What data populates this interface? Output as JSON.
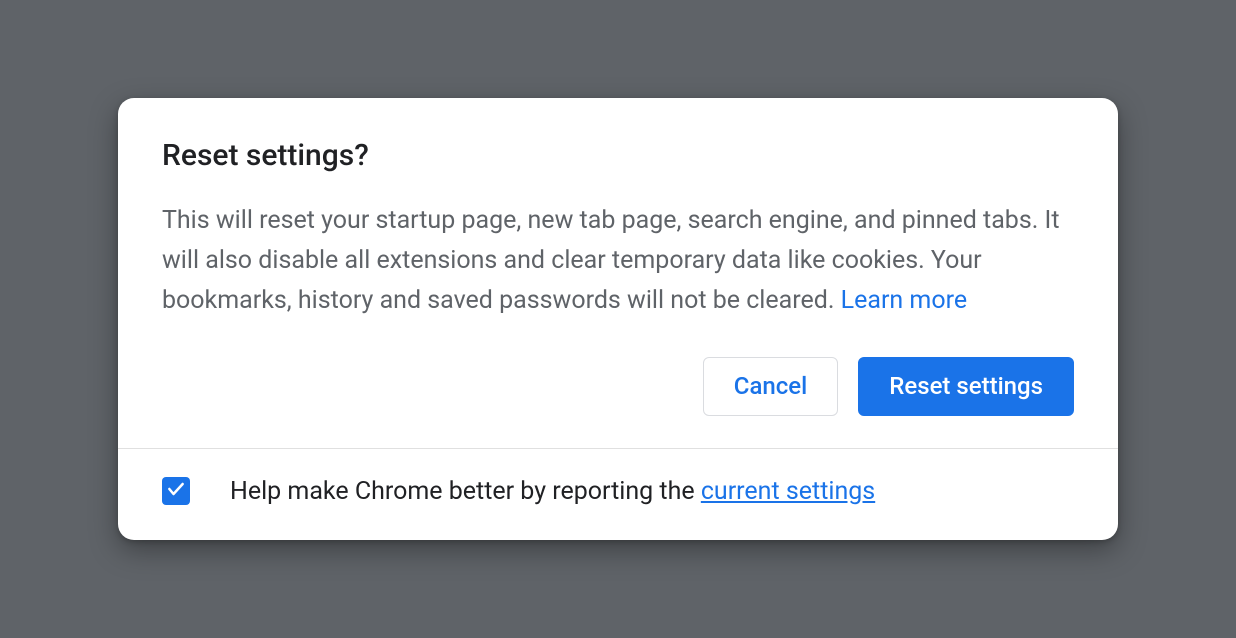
{
  "dialog": {
    "title": "Reset settings?",
    "description": "This will reset your startup page, new tab page, search engine, and pinned tabs. It will also disable all extensions and clear temporary data like cookies. Your bookmarks, history and saved passwords will not be cleared.",
    "learn_more": " Learn more",
    "actions": {
      "cancel": "Cancel",
      "confirm": "Reset settings"
    },
    "footer": {
      "checkbox_checked": true,
      "label_prefix": "Help make Chrome better by reporting the ",
      "label_link": "current settings"
    }
  }
}
